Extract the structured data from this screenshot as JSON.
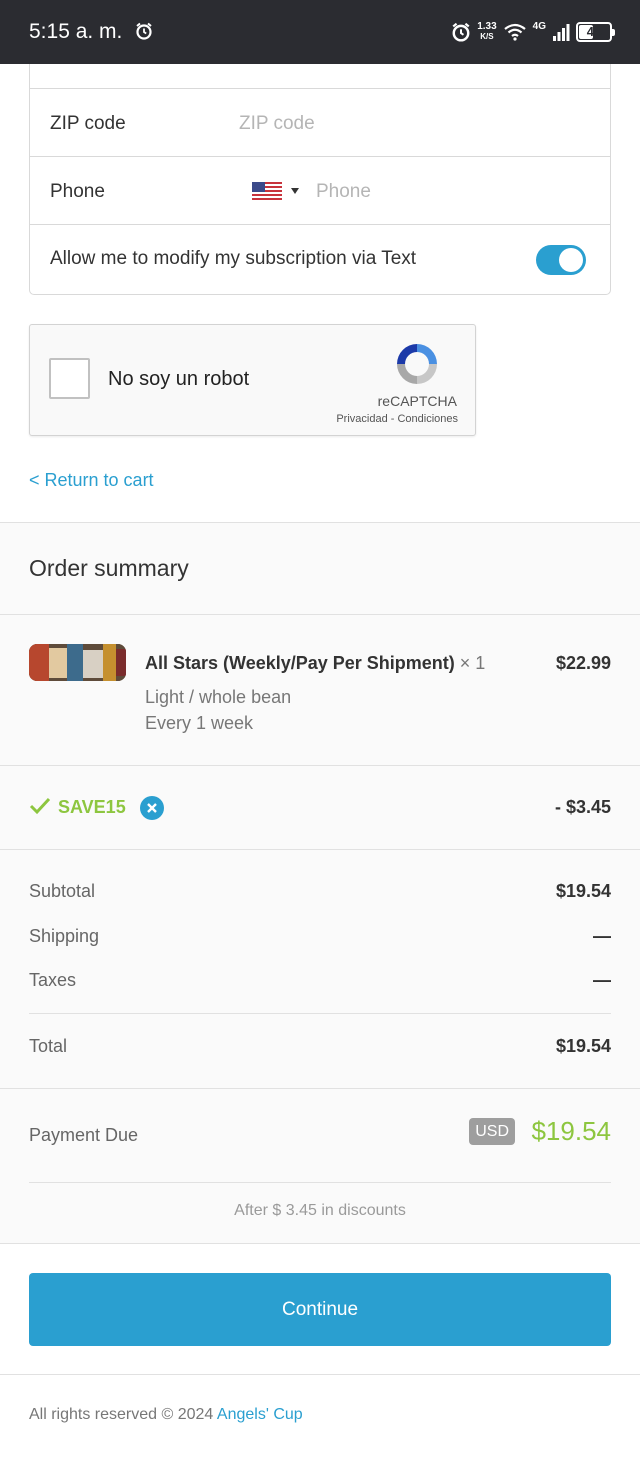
{
  "status_bar": {
    "time": "5:15 a. m.",
    "speed_value": "1.33",
    "speed_unit": "K/S",
    "network": "4G",
    "battery": "44",
    "battery_level": 0.44
  },
  "form": {
    "zip_label": "ZIP code",
    "zip_placeholder": "ZIP code",
    "phone_label": "Phone",
    "phone_placeholder": "Phone",
    "sms_label": "Allow me to modify my subscription via Text",
    "sms_enabled": true
  },
  "recaptcha": {
    "label": "No soy un robot",
    "brand": "reCAPTCHA",
    "links": "Privacidad - Condiciones"
  },
  "return_link": "< Return to cart",
  "summary": {
    "title": "Order summary",
    "product": {
      "name": "All Stars (Weekly/Pay Per Shipment)",
      "qty": "× 1",
      "price": "$22.99",
      "variant": "Light / whole bean",
      "frequency": "Every 1 week"
    },
    "discount": {
      "code": "SAVE15",
      "amount": "- $3.45"
    },
    "lines": {
      "subtotal_label": "Subtotal",
      "subtotal_value": "$19.54",
      "shipping_label": "Shipping",
      "shipping_value": "—",
      "taxes_label": "Taxes",
      "taxes_value": "—",
      "total_label": "Total",
      "total_value": "$19.54"
    },
    "payment_due": {
      "label": "Payment Due",
      "currency": "USD",
      "amount": "$19.54",
      "note": "After $ 3.45 in discounts"
    }
  },
  "continue_label": "Continue",
  "footer": {
    "text": "All rights reserved © 2024",
    "brand": "Angels' Cup"
  },
  "colors": {
    "accent": "#2a9fd0",
    "success": "#8dc63f",
    "status_bar": "#2b2c31"
  }
}
